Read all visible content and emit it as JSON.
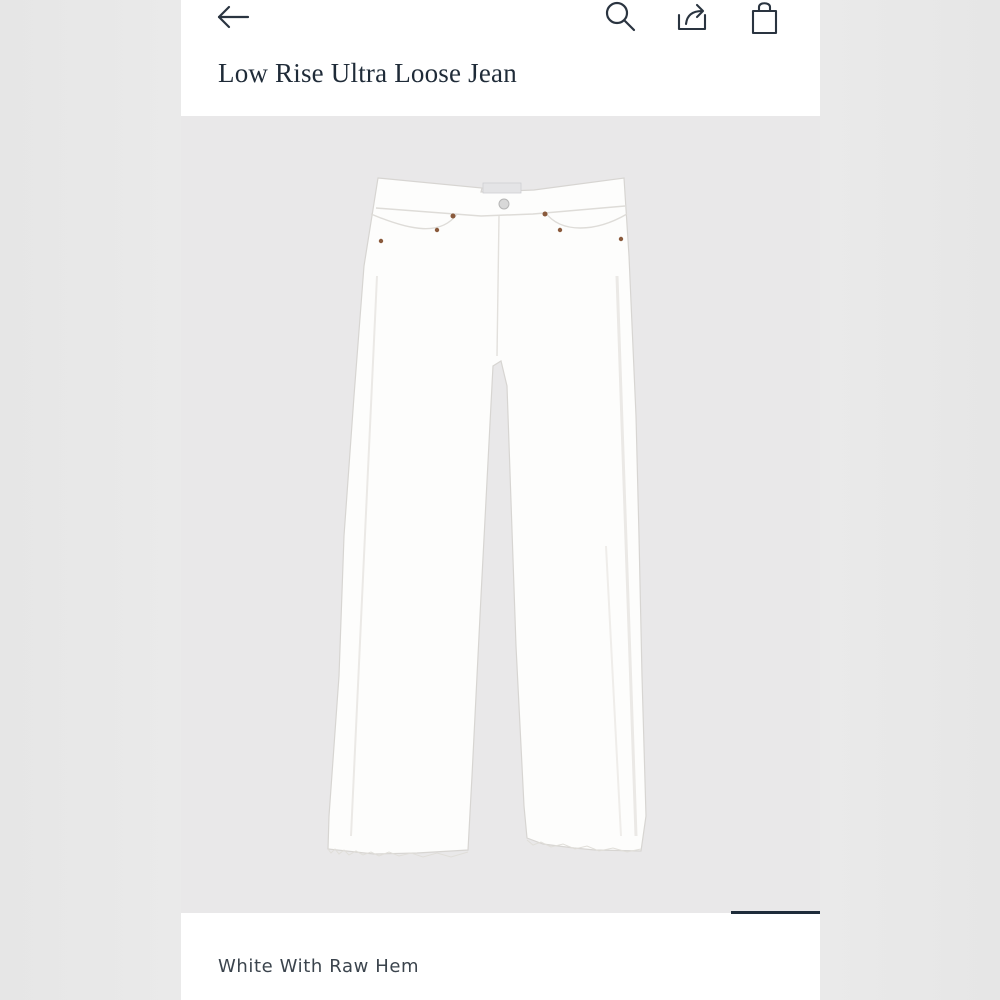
{
  "header": {
    "back_icon": "arrow-left-icon",
    "search_icon": "search-icon",
    "share_icon": "share-icon",
    "bag_icon": "shopping-bag-icon"
  },
  "product": {
    "title": "Low Rise Ultra Loose Jean",
    "variant": "White With Raw Hem",
    "image_alt": "White low rise ultra loose jeans with raw hem"
  },
  "carousel": {
    "progress_fraction": 0.14
  },
  "colors": {
    "text_primary": "#1f2b38",
    "image_background": "#e9e8e9",
    "progress_indicator": "#1e2c3a"
  }
}
